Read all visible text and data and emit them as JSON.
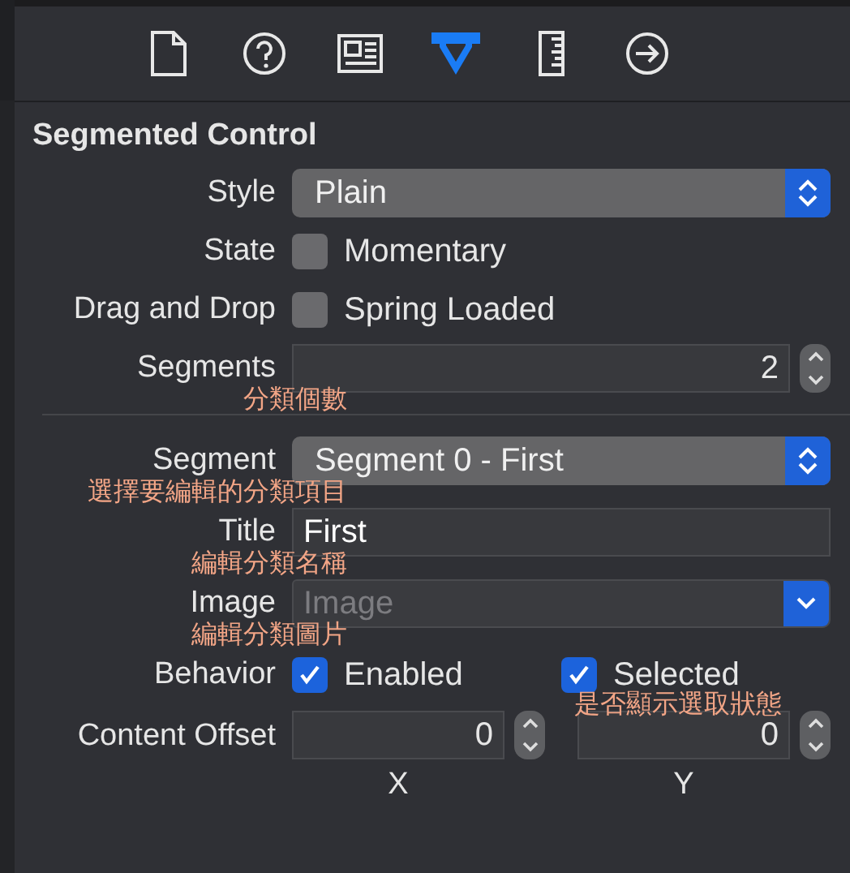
{
  "inspector_tabs": [
    {
      "kind": "file",
      "selected": false
    },
    {
      "kind": "help",
      "selected": false
    },
    {
      "kind": "identity",
      "selected": false
    },
    {
      "kind": "attributes",
      "selected": true
    },
    {
      "kind": "size",
      "selected": false
    },
    {
      "kind": "connections",
      "selected": false
    }
  ],
  "section_title": "Segmented Control",
  "rows": [
    {
      "kind": "popup",
      "label": "Style",
      "value": "Plain"
    },
    {
      "kind": "checkbox",
      "label": "State",
      "option": "Momentary",
      "checked": false
    },
    {
      "kind": "checkbox",
      "label": "Drag and Drop",
      "option": "Spring Loaded",
      "checked": false
    },
    {
      "kind": "stepper",
      "label": "Segments",
      "value": "2",
      "note": "分類個數"
    },
    {
      "kind": "divider"
    },
    {
      "kind": "popup",
      "label": "Segment",
      "value": "Segment 0 - First",
      "note": "選擇要編輯的分類項目"
    },
    {
      "kind": "text",
      "label": "Title",
      "value": "First",
      "note": "編輯分類名稱"
    },
    {
      "kind": "combo",
      "label": "Image",
      "placeholder": "Image",
      "note": "編輯分類圖片"
    },
    {
      "kind": "checkboxes",
      "label": "Behavior",
      "options": [
        {
          "text": "Enabled",
          "checked": true
        },
        {
          "text": "Selected",
          "checked": true,
          "note": "是否顯示選取狀態"
        }
      ]
    },
    {
      "kind": "offset",
      "label": "Content Offset",
      "fields": [
        {
          "value": "0",
          "axis": "X"
        },
        {
          "value": "0",
          "axis": "Y"
        }
      ]
    }
  ]
}
